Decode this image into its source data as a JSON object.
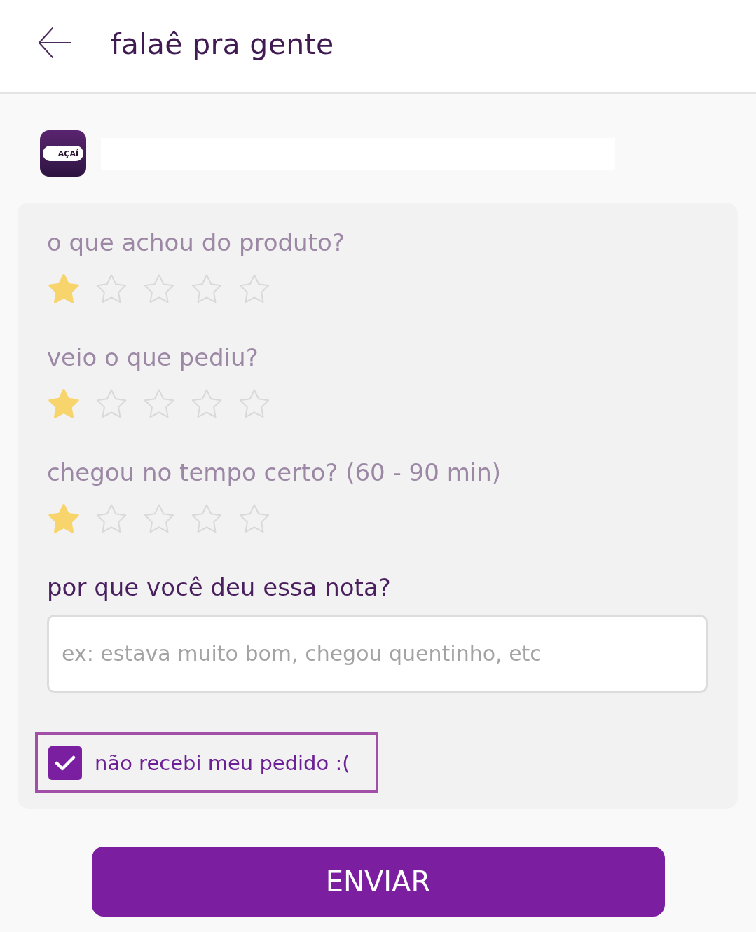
{
  "header": {
    "title": "falaê pra gente"
  },
  "store": {
    "logo_text": "AÇAÍ"
  },
  "questions": [
    {
      "label": "o que achou do produto?",
      "stars": 1
    },
    {
      "label": "veio o que pediu?",
      "stars": 1
    },
    {
      "label": "chegou no tempo certo? (60 - 90 min)",
      "stars": 1
    }
  ],
  "comment": {
    "label": "por que você deu essa nota?",
    "placeholder": "ex: estava muito bom, chegou quentinho, etc"
  },
  "not_received": {
    "label": "não recebi meu pedido :(",
    "checked": true
  },
  "submit_button": {
    "label": "ENVIAR"
  }
}
